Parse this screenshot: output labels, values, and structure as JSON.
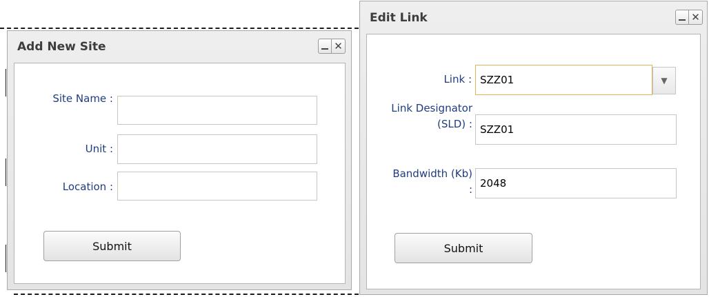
{
  "add_site": {
    "title": "Add New Site",
    "fields": {
      "site_name": {
        "label": "Site Name :",
        "value": ""
      },
      "unit": {
        "label": "Unit :",
        "value": ""
      },
      "location": {
        "label": "Location :",
        "value": ""
      }
    },
    "submit_label": "Submit"
  },
  "edit_link": {
    "title": "Edit Link",
    "fields": {
      "link": {
        "label": "Link :",
        "value": "SZZ01"
      },
      "designator": {
        "label": "Link Designator (SLD) :",
        "value": "SZZ01"
      },
      "bandwidth": {
        "label": "Bandwidth (Kb) :",
        "value": "2048"
      }
    },
    "submit_label": "Submit"
  },
  "icons": {
    "minimize": "minimize-icon",
    "close": "close-icon",
    "dropdown": "chevron-down-icon"
  },
  "colors": {
    "label": "#1f3c80",
    "focus_border": "#e3b25d",
    "title": "#3d3d3d"
  }
}
